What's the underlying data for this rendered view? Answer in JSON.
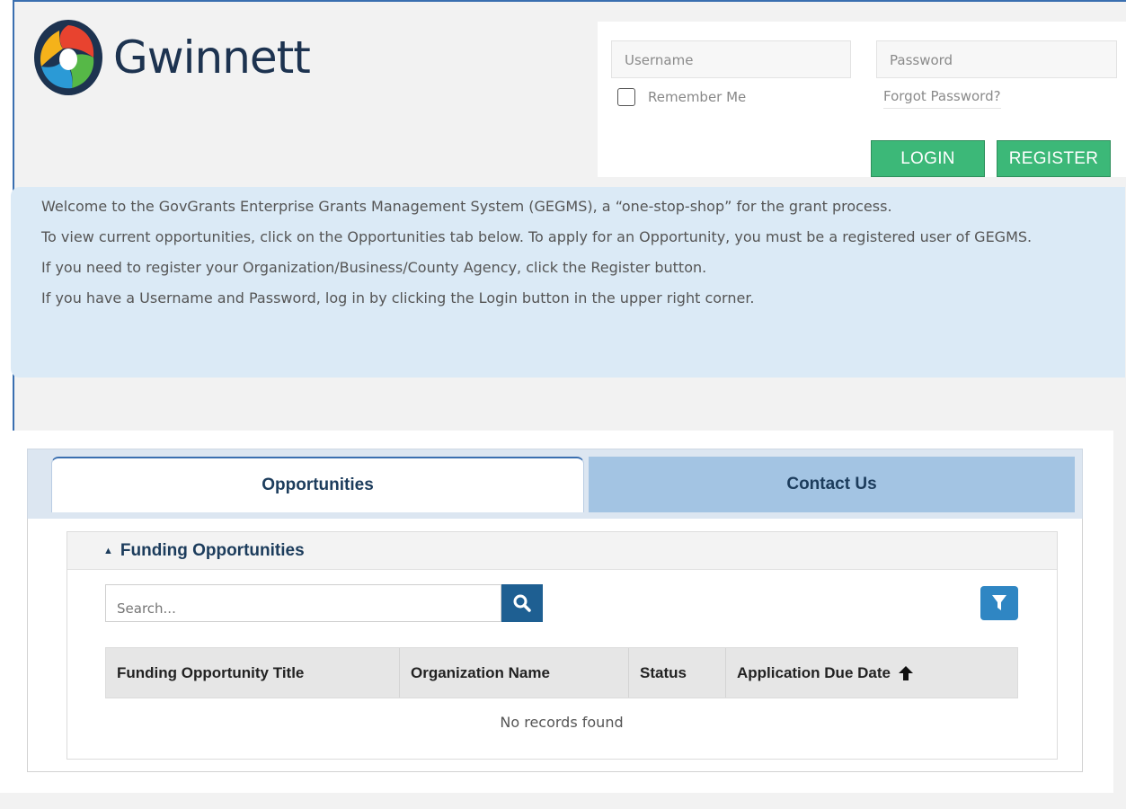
{
  "header": {
    "logo_text": "Gwinnett",
    "logo_colors": [
      "#1d3350",
      "#e8432f",
      "#f5b21a",
      "#56b847",
      "#2b9ad6"
    ]
  },
  "login": {
    "username_placeholder": "Username",
    "password_placeholder": "Password",
    "remember_label": "Remember Me",
    "remember_checked": false,
    "forgot_label": "Forgot Password?",
    "login_label": "LOGIN",
    "register_label": "REGISTER",
    "button_color": "#3cb878"
  },
  "welcome": {
    "p1": "Welcome to the GovGrants Enterprise Grants Management System (GEGMS), a “one-stop-shop” for the grant process.",
    "p2": "To view current opportunities, click on the Opportunities tab below. To apply for an Opportunity, you must be a registered user of GEGMS.",
    "p3": "If you need to register your Organization/Business/County Agency, click the Register button.",
    "p4": "If you have a Username and Password, log in by clicking the Login button in the upper right corner."
  },
  "tabs": [
    {
      "label": "Opportunities",
      "active": true
    },
    {
      "label": "Contact Us",
      "active": false
    }
  ],
  "funding": {
    "section_title": "Funding Opportunities",
    "search_placeholder": "Search...",
    "search_icon": "search-icon",
    "filter_icon": "filter-icon",
    "columns": [
      "Funding Opportunity Title",
      "Organization Name",
      "Status",
      "Application Due Date"
    ],
    "sort_column": "Application Due Date",
    "sort_direction": "ascending",
    "empty_message": "No records found"
  }
}
